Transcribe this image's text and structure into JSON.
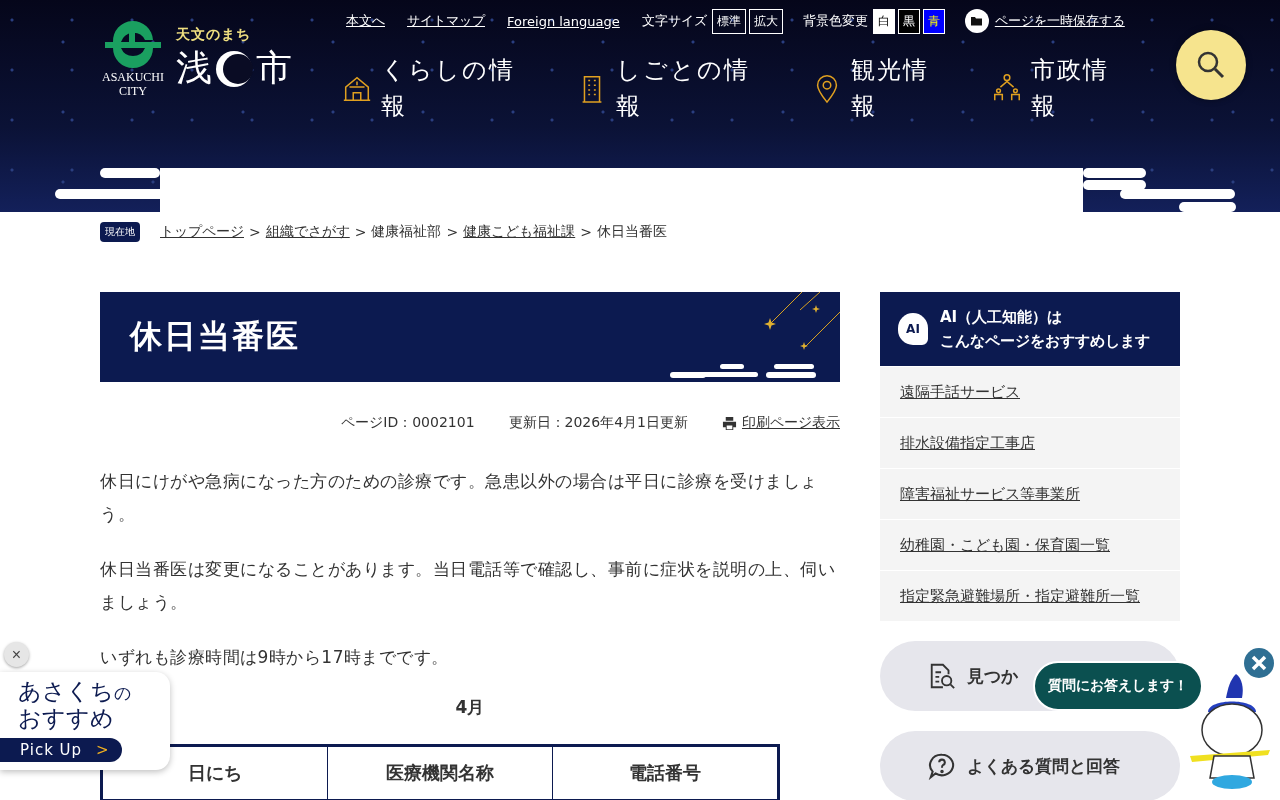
{
  "logo": {
    "emblem_text": "ASAKUCHI",
    "emblem_text_2": "CITY",
    "tagline": "天文のまち",
    "city_name_1": "浅",
    "city_name_2": "市"
  },
  "top_links": [
    {
      "label": "本文へ"
    },
    {
      "label": "サイトマップ"
    },
    {
      "label": "Foreign language"
    }
  ],
  "font_size": {
    "label": "文字サイズ",
    "options": [
      "標準",
      "拡大"
    ]
  },
  "background_color": {
    "label": "背景色変更",
    "options": [
      {
        "label": "白",
        "color": "#ffffff"
      },
      {
        "label": "黒",
        "color": "#000000"
      },
      {
        "label": "青",
        "color": "#0000ff"
      }
    ]
  },
  "save_page": {
    "label": "ページを一時保存する"
  },
  "nav": [
    {
      "label": "くらしの情報",
      "kind": "house"
    },
    {
      "label": "しごとの情報",
      "kind": "building"
    },
    {
      "label": "観光情報",
      "kind": "pin"
    },
    {
      "label": "市政情報",
      "kind": "people"
    }
  ],
  "breadcrumb": {
    "badge": "現在地",
    "items": [
      {
        "label": "トップページ",
        "link": true
      },
      {
        "label": "組織でさがす",
        "link": true
      },
      {
        "label": "健康福祉部",
        "link": false
      },
      {
        "label": "健康こども福祉課",
        "link": true
      },
      {
        "label": "休日当番医",
        "link": false
      }
    ],
    "separator": ">"
  },
  "page_title": "休日当番医",
  "meta": {
    "page_id": "ページID：0002101",
    "updated": "更新日：2026年4月1日更新",
    "print": "印刷ページ表示"
  },
  "paragraphs": [
    "休日にけがや急病になった方のための診療です。急患以外の場合は平日に診療を受けましょう。",
    "休日当番医は変更になることがあります。当日電話等で確認し、事前に症状を説明の上、伺いましょう。",
    "いずれも診療時間は9時から17時までです。"
  ],
  "table": {
    "caption": "4月",
    "columns": [
      "日にち",
      "医療機関名称",
      "電話番号"
    ]
  },
  "ai_panel": {
    "title_1": "AI（人工知能）は",
    "title_2": "こんなページをおすすめします",
    "icon_text": "AI",
    "items": [
      "遠隔手話サービス",
      "排水設備指定工事店",
      "障害福祉サービス等事業所",
      "幼稚園・こども園・保育園一覧",
      "指定緊急避難場所・指定避難所一覧"
    ]
  },
  "side_buttons": [
    {
      "label": "見つか",
      "kind": "search"
    },
    {
      "label": "よくある質問と回答",
      "kind": "question"
    }
  ],
  "pickup": {
    "close": "×",
    "line_1": "あさくち",
    "line_1_small": "の",
    "line_2": "おすすめ",
    "button": "Pick Up",
    "arrow": ">"
  },
  "chat": {
    "bubble": "質問にお答えします！"
  }
}
